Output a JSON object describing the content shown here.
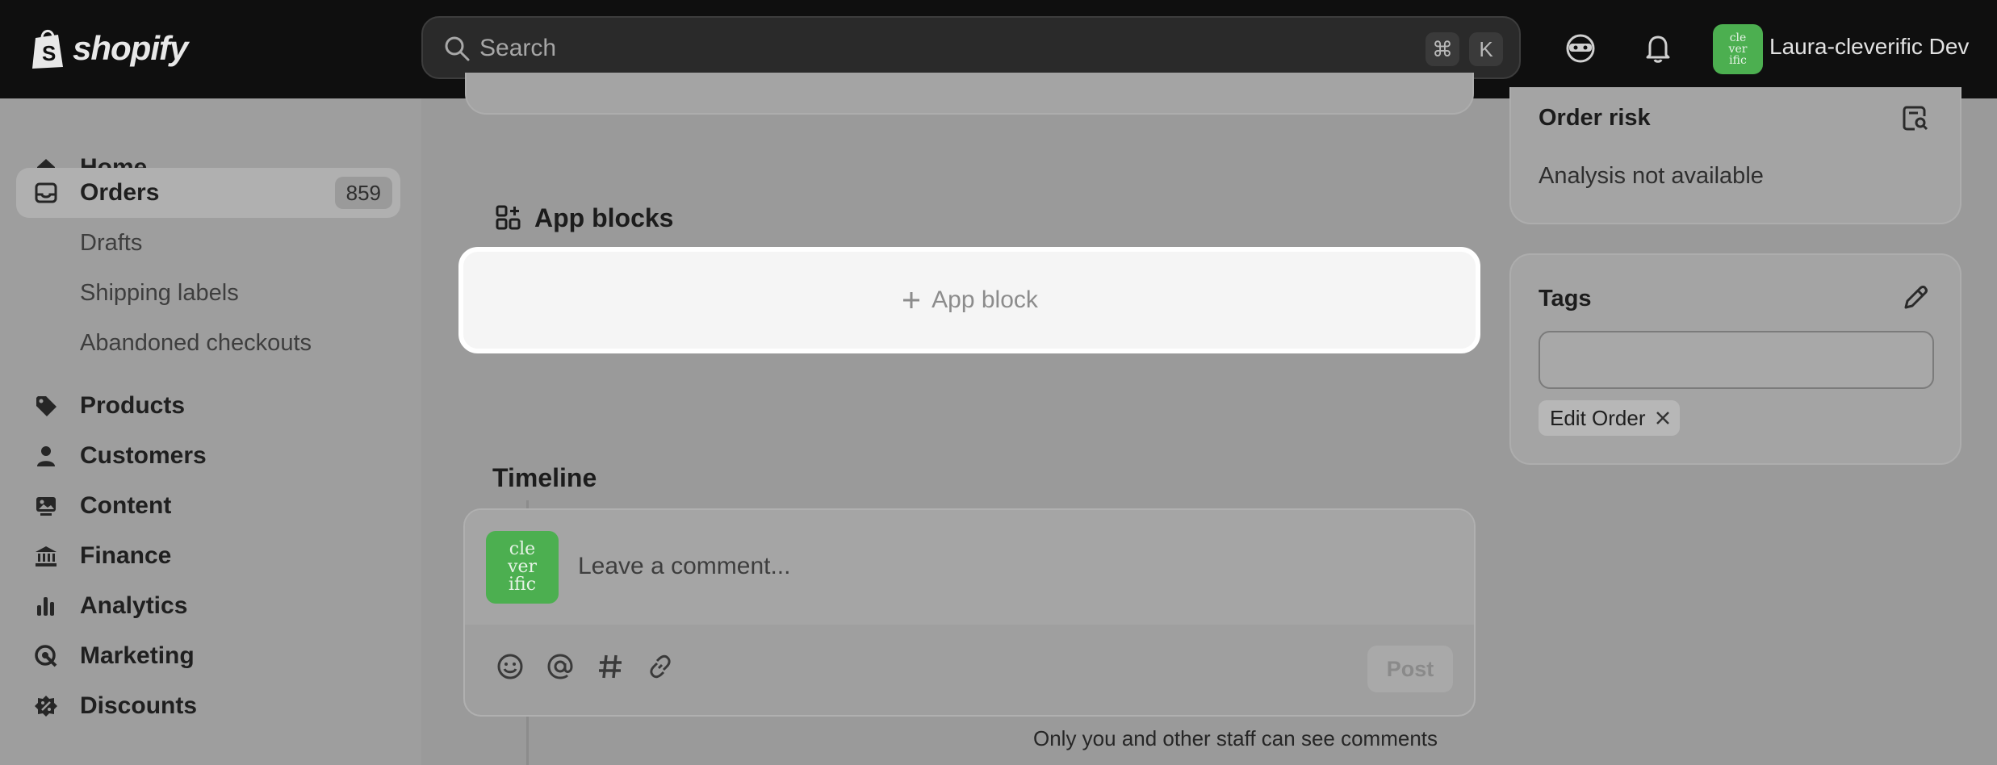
{
  "topbar": {
    "brand": "shopify",
    "search_placeholder": "Search",
    "shortcut_keys": [
      "⌘",
      "K"
    ],
    "store_name": "Laura-cleverific Dev",
    "store_avatar_lines": [
      "cle",
      "ver",
      "ific"
    ]
  },
  "sidebar": {
    "items": [
      {
        "label": "Home",
        "icon": "home-icon"
      },
      {
        "label": "Orders",
        "icon": "inbox-icon",
        "badge": "859",
        "active": true
      },
      {
        "label": "Drafts",
        "sub": true
      },
      {
        "label": "Shipping labels",
        "sub": true
      },
      {
        "label": "Abandoned checkouts",
        "sub": true
      },
      {
        "label": "Products",
        "icon": "tag-icon"
      },
      {
        "label": "Customers",
        "icon": "person-icon"
      },
      {
        "label": "Content",
        "icon": "image-icon"
      },
      {
        "label": "Finance",
        "icon": "bank-icon"
      },
      {
        "label": "Analytics",
        "icon": "bar-chart-icon"
      },
      {
        "label": "Marketing",
        "icon": "target-icon"
      },
      {
        "label": "Discounts",
        "icon": "discount-icon"
      }
    ]
  },
  "main": {
    "app_blocks_title": "App blocks",
    "app_block_button": "App block",
    "timeline_title": "Timeline",
    "comment_placeholder": "Leave a comment...",
    "comment_avatar_lines": [
      "cle",
      "ver",
      "ific"
    ],
    "post_label": "Post",
    "staff_note": "Only you and other staff can see comments"
  },
  "right": {
    "order_risk_title": "Order risk",
    "order_risk_text": "Analysis not available",
    "tags_title": "Tags",
    "tags": [
      "Edit Order"
    ]
  },
  "colors": {
    "topbar": "#0f0f0f",
    "brand_green": "#4caf50",
    "overlay_gray": "#9a9a9a",
    "highlight_white": "#f5f5f5"
  }
}
